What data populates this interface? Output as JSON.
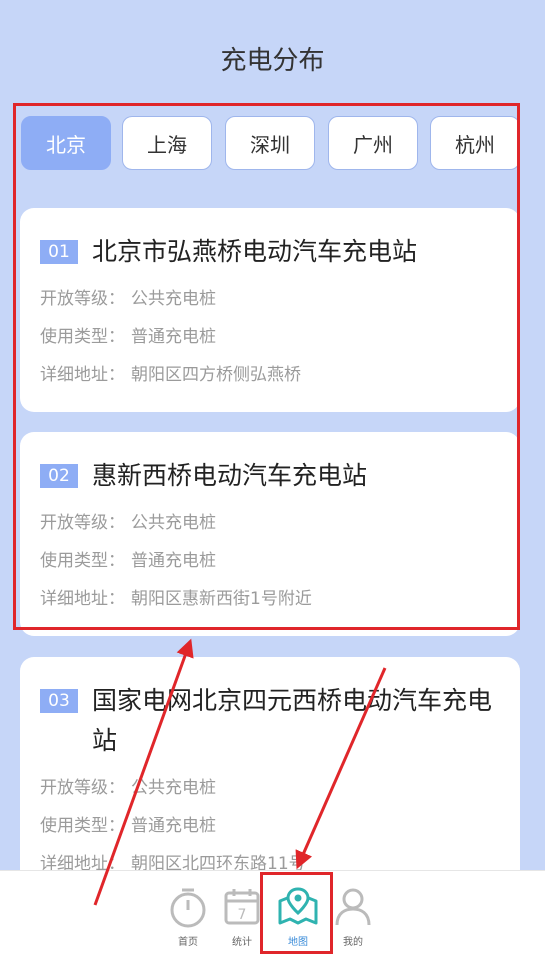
{
  "page": {
    "title": "充电分布"
  },
  "tabs": [
    "北京",
    "上海",
    "深圳",
    "广州",
    "杭州"
  ],
  "labels": {
    "level": "开放等级：",
    "type": "使用类型：",
    "address": "详细地址："
  },
  "stations": [
    {
      "num": "01",
      "name": "北京市弘燕桥电动汽车充电站",
      "level": "公共充电桩",
      "type": "普通充电桩",
      "address": "朝阳区四方桥侧弘燕桥"
    },
    {
      "num": "02",
      "name": "惠新西桥电动汽车充电站",
      "level": "公共充电桩",
      "type": "普通充电桩",
      "address": "朝阳区惠新西街1号附近"
    },
    {
      "num": "03",
      "name": "国家电网北京四元西桥电动汽车充电站",
      "level": "公共充电桩",
      "type": "普通充电桩",
      "address": "朝阳区北四环东路11号"
    }
  ],
  "nav": {
    "items": [
      {
        "label": "首页",
        "icon": "timer-icon"
      },
      {
        "label": "统计",
        "icon": "calendar-icon"
      },
      {
        "label": "地图",
        "icon": "map-icon"
      },
      {
        "label": "我的",
        "icon": "user-icon"
      }
    ],
    "stat_day": "7"
  },
  "colors": {
    "accent": "#8eadf5",
    "background": "#c6d6f8",
    "highlight": "#e0262a",
    "nav_active": "#3a8bd8"
  }
}
